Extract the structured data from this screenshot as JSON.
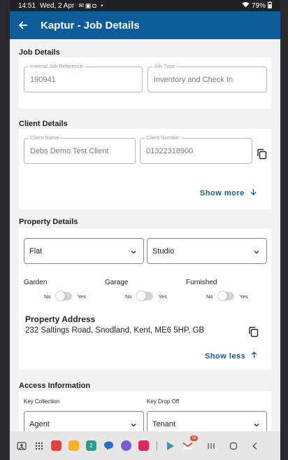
{
  "status_bar": {
    "time": "14:51",
    "date": "Wed, 2 Apr",
    "battery": "79%"
  },
  "app_bar": {
    "title": "Kaptur - Job Details"
  },
  "job_details": {
    "section_title": "Job Details",
    "internal_ref_label": "Internal Job Reference",
    "internal_ref_value": "190941",
    "job_type_label": "Job Type",
    "job_type_value": "Inventory and Check In"
  },
  "client_details": {
    "section_title": "Client Details",
    "client_name_label": "Client Name",
    "client_name_value": "Debs Demo Test Client",
    "client_number_label": "Client Number",
    "client_number_value": "01322318900",
    "show_more_label": "Show more"
  },
  "property_details": {
    "section_title": "Property Details",
    "property_type_value": "Flat",
    "property_subtype_value": "Studio",
    "toggles": [
      {
        "label": "Garden",
        "no": "No",
        "yes": "Yes"
      },
      {
        "label": "Garage",
        "no": "No",
        "yes": "Yes"
      },
      {
        "label": "Furnished",
        "no": "No",
        "yes": "Yes"
      }
    ],
    "address_heading": "Property Address",
    "address_value": "232 Saltings Road, Snodland, Kent, ME6 5HP, GB",
    "show_less_label": "Show less"
  },
  "access_information": {
    "section_title": "Access Information",
    "key_collection_label": "Key Collection",
    "key_collection_value": "Agent",
    "key_drop_off_label": "Key Drop Off",
    "key_drop_off_value": "Tenant"
  },
  "nav_bar": {
    "mail_badge": "18"
  },
  "colors": {
    "app_bar": "#0d5c9a",
    "link": "#0d5c9a",
    "background": "#f2f2f2"
  }
}
